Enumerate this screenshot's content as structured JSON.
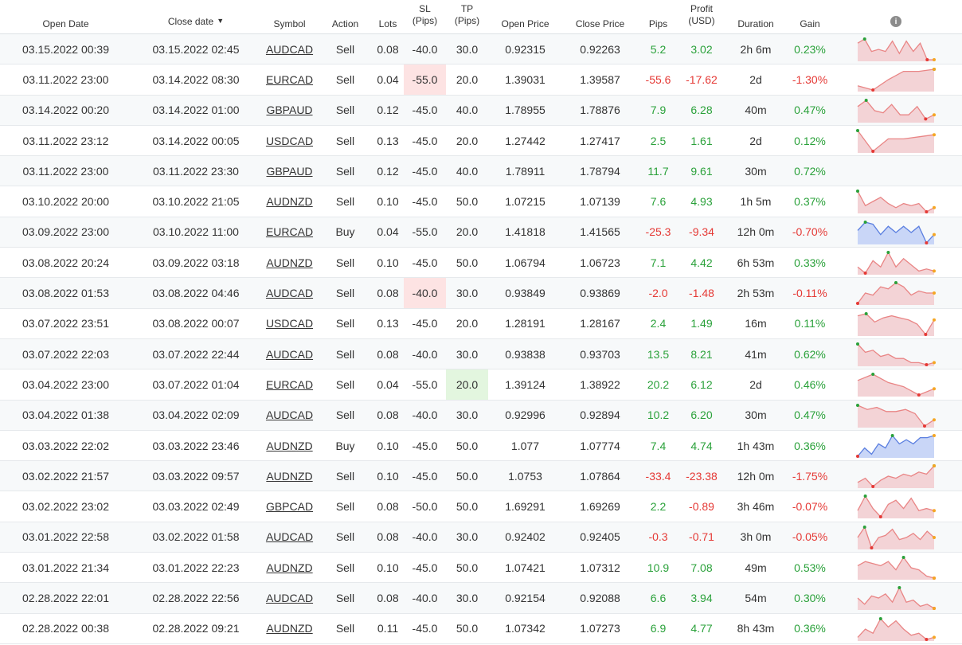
{
  "headers": {
    "open_date": "Open Date",
    "close_date": "Close date",
    "symbol": "Symbol",
    "action": "Action",
    "lots": "Lots",
    "sl_line1": "SL",
    "sl_line2": "(Pips)",
    "tp_line1": "TP",
    "tp_line2": "(Pips)",
    "open_price": "Open Price",
    "close_price": "Close Price",
    "pips": "Pips",
    "profit_line1": "Profit",
    "profit_line2": "(USD)",
    "duration": "Duration",
    "gain": "Gain",
    "sort_arrow": "▼",
    "info_icon": "i"
  },
  "colors": {
    "positive": "#2aa13a",
    "negative": "#e53935",
    "sell_fill": "#f3d3d6",
    "sell_line": "#e98585",
    "buy_fill": "#c9d6f7",
    "buy_line": "#5b7fe0"
  },
  "trades": [
    {
      "open": "03.15.2022 00:39",
      "close": "03.15.2022 02:45",
      "symbol": "AUDCAD",
      "action": "Sell",
      "lots": "0.08",
      "sl": "-40.0",
      "tp": "30.0",
      "open_price": "0.92315",
      "close_price": "0.92263",
      "pips": "5.2",
      "profit": "3.02",
      "duration": "2h 6m",
      "gain": "0.23%",
      "sign": "pos",
      "spark": [
        0.8,
        1.0,
        0.4,
        0.5,
        0.4,
        0.9,
        0.3,
        0.9,
        0.4,
        0.8,
        0.0,
        0.0
      ],
      "spark_type": "sell"
    },
    {
      "open": "03.11.2022 23:00",
      "close": "03.14.2022 08:30",
      "symbol": "EURCAD",
      "action": "Sell",
      "lots": "0.04",
      "sl": "-55.0",
      "tp": "20.0",
      "open_price": "1.39031",
      "close_price": "1.39587",
      "pips": "-55.6",
      "profit": "-17.62",
      "duration": "2d",
      "gain": "-1.30%",
      "sign": "neg",
      "sl_hl": "red",
      "spark": [
        0.2,
        0.0,
        0.5,
        0.9,
        0.9,
        1.0
      ],
      "spark_type": "sell"
    },
    {
      "open": "03.14.2022 00:20",
      "close": "03.14.2022 01:00",
      "symbol": "GBPAUD",
      "action": "Sell",
      "lots": "0.12",
      "sl": "-45.0",
      "tp": "40.0",
      "open_price": "1.78955",
      "close_price": "1.78876",
      "pips": "7.9",
      "profit": "6.28",
      "duration": "40m",
      "gain": "0.47%",
      "sign": "pos",
      "spark": [
        0.7,
        1.0,
        0.5,
        0.4,
        0.8,
        0.3,
        0.3,
        0.7,
        0.1,
        0.3
      ],
      "spark_type": "sell"
    },
    {
      "open": "03.11.2022 23:12",
      "close": "03.14.2022 00:05",
      "symbol": "USDCAD",
      "action": "Sell",
      "lots": "0.13",
      "sl": "-45.0",
      "tp": "20.0",
      "open_price": "1.27442",
      "close_price": "1.27417",
      "pips": "2.5",
      "profit": "1.61",
      "duration": "2d",
      "gain": "0.12%",
      "sign": "pos",
      "spark": [
        1.0,
        0.0,
        0.6,
        0.6,
        0.7,
        0.8
      ],
      "spark_type": "sell"
    },
    {
      "open": "03.11.2022 23:00",
      "close": "03.11.2022 23:30",
      "symbol": "GBPAUD",
      "action": "Sell",
      "lots": "0.12",
      "sl": "-45.0",
      "tp": "40.0",
      "open_price": "1.78911",
      "close_price": "1.78794",
      "pips": "11.7",
      "profit": "9.61",
      "duration": "30m",
      "gain": "0.72%",
      "sign": "pos",
      "spark": null,
      "spark_type": "none"
    },
    {
      "open": "03.10.2022 20:00",
      "close": "03.10.2022 21:05",
      "symbol": "AUDNZD",
      "action": "Sell",
      "lots": "0.10",
      "sl": "-45.0",
      "tp": "50.0",
      "open_price": "1.07215",
      "close_price": "1.07139",
      "pips": "7.6",
      "profit": "4.93",
      "duration": "1h 5m",
      "gain": "0.37%",
      "sign": "pos",
      "spark": [
        1.0,
        0.3,
        0.5,
        0.7,
        0.4,
        0.2,
        0.4,
        0.3,
        0.4,
        0.0,
        0.2
      ],
      "spark_type": "sell"
    },
    {
      "open": "03.09.2022 23:00",
      "close": "03.10.2022 11:00",
      "symbol": "EURCAD",
      "action": "Buy",
      "lots": "0.04",
      "sl": "-55.0",
      "tp": "20.0",
      "open_price": "1.41818",
      "close_price": "1.41565",
      "pips": "-25.3",
      "profit": "-9.34",
      "duration": "12h 0m",
      "gain": "-0.70%",
      "sign": "neg",
      "spark": [
        0.6,
        1.0,
        0.9,
        0.4,
        0.8,
        0.5,
        0.8,
        0.5,
        0.8,
        0.0,
        0.4
      ],
      "spark_type": "buy"
    },
    {
      "open": "03.08.2022 20:24",
      "close": "03.09.2022 03:18",
      "symbol": "AUDNZD",
      "action": "Sell",
      "lots": "0.10",
      "sl": "-45.0",
      "tp": "50.0",
      "open_price": "1.06794",
      "close_price": "1.06723",
      "pips": "7.1",
      "profit": "4.42",
      "duration": "6h 53m",
      "gain": "0.33%",
      "sign": "pos",
      "spark": [
        0.3,
        0.0,
        0.6,
        0.3,
        1.0,
        0.3,
        0.7,
        0.4,
        0.1,
        0.2,
        0.1
      ],
      "spark_type": "sell"
    },
    {
      "open": "03.08.2022 01:53",
      "close": "03.08.2022 04:46",
      "symbol": "AUDCAD",
      "action": "Sell",
      "lots": "0.08",
      "sl": "-40.0",
      "tp": "30.0",
      "open_price": "0.93849",
      "close_price": "0.93869",
      "pips": "-2.0",
      "profit": "-1.48",
      "duration": "2h 53m",
      "gain": "-0.11%",
      "sign": "neg",
      "sl_hl": "red",
      "spark": [
        0.0,
        0.5,
        0.4,
        0.8,
        0.7,
        1.0,
        0.8,
        0.4,
        0.6,
        0.5,
        0.5
      ],
      "spark_type": "sell"
    },
    {
      "open": "03.07.2022 23:51",
      "close": "03.08.2022 00:07",
      "symbol": "USDCAD",
      "action": "Sell",
      "lots": "0.13",
      "sl": "-45.0",
      "tp": "20.0",
      "open_price": "1.28191",
      "close_price": "1.28167",
      "pips": "2.4",
      "profit": "1.49",
      "duration": "16m",
      "gain": "0.11%",
      "sign": "pos",
      "spark": [
        0.9,
        1.0,
        0.6,
        0.8,
        0.9,
        0.8,
        0.7,
        0.5,
        0.0,
        0.7
      ],
      "spark_type": "sell"
    },
    {
      "open": "03.07.2022 22:03",
      "close": "03.07.2022 22:44",
      "symbol": "AUDCAD",
      "action": "Sell",
      "lots": "0.08",
      "sl": "-40.0",
      "tp": "30.0",
      "open_price": "0.93838",
      "close_price": "0.93703",
      "pips": "13.5",
      "profit": "8.21",
      "duration": "41m",
      "gain": "0.62%",
      "sign": "pos",
      "spark": [
        1.0,
        0.6,
        0.7,
        0.4,
        0.5,
        0.3,
        0.3,
        0.1,
        0.1,
        0.0,
        0.1
      ],
      "spark_type": "sell"
    },
    {
      "open": "03.04.2022 23:00",
      "close": "03.07.2022 01:04",
      "symbol": "EURCAD",
      "action": "Sell",
      "lots": "0.04",
      "sl": "-55.0",
      "tp": "20.0",
      "open_price": "1.39124",
      "close_price": "1.38922",
      "pips": "20.2",
      "profit": "6.12",
      "duration": "2d",
      "gain": "0.46%",
      "sign": "pos",
      "tp_hl": "green",
      "spark": [
        0.7,
        1.0,
        0.6,
        0.4,
        0.0,
        0.3
      ],
      "spark_type": "sell"
    },
    {
      "open": "03.04.2022 01:38",
      "close": "03.04.2022 02:09",
      "symbol": "AUDCAD",
      "action": "Sell",
      "lots": "0.08",
      "sl": "-40.0",
      "tp": "30.0",
      "open_price": "0.92996",
      "close_price": "0.92894",
      "pips": "10.2",
      "profit": "6.20",
      "duration": "30m",
      "gain": "0.47%",
      "sign": "pos",
      "spark": [
        1.0,
        0.8,
        0.9,
        0.7,
        0.7,
        0.8,
        0.6,
        0.0,
        0.3
      ],
      "spark_type": "sell"
    },
    {
      "open": "03.03.2022 22:02",
      "close": "03.03.2022 23:46",
      "symbol": "AUDNZD",
      "action": "Buy",
      "lots": "0.10",
      "sl": "-45.0",
      "tp": "50.0",
      "open_price": "1.077",
      "close_price": "1.07774",
      "pips": "7.4",
      "profit": "4.74",
      "duration": "1h 43m",
      "gain": "0.36%",
      "sign": "pos",
      "spark": [
        0.0,
        0.4,
        0.1,
        0.6,
        0.4,
        1.0,
        0.6,
        0.8,
        0.6,
        0.9,
        0.9,
        1.0
      ],
      "spark_type": "buy"
    },
    {
      "open": "03.02.2022 21:57",
      "close": "03.03.2022 09:57",
      "symbol": "AUDNZD",
      "action": "Sell",
      "lots": "0.10",
      "sl": "-45.0",
      "tp": "50.0",
      "open_price": "1.0753",
      "close_price": "1.07864",
      "pips": "-33.4",
      "profit": "-23.38",
      "duration": "12h 0m",
      "gain": "-1.75%",
      "sign": "neg",
      "spark": [
        0.2,
        0.4,
        0.0,
        0.3,
        0.5,
        0.4,
        0.6,
        0.5,
        0.7,
        0.6,
        1.0
      ],
      "spark_type": "sell"
    },
    {
      "open": "03.02.2022 23:02",
      "close": "03.03.2022 02:49",
      "symbol": "GBPCAD",
      "action": "Sell",
      "lots": "0.08",
      "sl": "-50.0",
      "tp": "50.0",
      "open_price": "1.69291",
      "close_price": "1.69269",
      "pips": "2.2",
      "profit": "-0.89",
      "duration": "3h 46m",
      "gain": "-0.07%",
      "sign": "mixed",
      "spark": [
        0.3,
        1.0,
        0.4,
        0.0,
        0.6,
        0.8,
        0.4,
        0.9,
        0.3,
        0.4,
        0.3
      ],
      "spark_type": "sell"
    },
    {
      "open": "03.01.2022 22:58",
      "close": "03.02.2022 01:58",
      "symbol": "AUDCAD",
      "action": "Sell",
      "lots": "0.08",
      "sl": "-40.0",
      "tp": "30.0",
      "open_price": "0.92402",
      "close_price": "0.92405",
      "pips": "-0.3",
      "profit": "-0.71",
      "duration": "3h 0m",
      "gain": "-0.05%",
      "sign": "neg",
      "spark": [
        0.5,
        1.0,
        0.0,
        0.5,
        0.6,
        0.9,
        0.4,
        0.5,
        0.7,
        0.4,
        0.8,
        0.5
      ],
      "spark_type": "sell"
    },
    {
      "open": "03.01.2022 21:34",
      "close": "03.01.2022 22:23",
      "symbol": "AUDNZD",
      "action": "Sell",
      "lots": "0.10",
      "sl": "-45.0",
      "tp": "50.0",
      "open_price": "1.07421",
      "close_price": "1.07312",
      "pips": "10.9",
      "profit": "7.08",
      "duration": "49m",
      "gain": "0.53%",
      "sign": "pos",
      "spark": [
        0.6,
        0.8,
        0.7,
        0.6,
        0.8,
        0.4,
        1.0,
        0.5,
        0.4,
        0.1,
        0.0
      ],
      "spark_type": "sell"
    },
    {
      "open": "02.28.2022 22:01",
      "close": "02.28.2022 22:56",
      "symbol": "AUDCAD",
      "action": "Sell",
      "lots": "0.08",
      "sl": "-40.0",
      "tp": "30.0",
      "open_price": "0.92154",
      "close_price": "0.92088",
      "pips": "6.6",
      "profit": "3.94",
      "duration": "54m",
      "gain": "0.30%",
      "sign": "pos",
      "spark": [
        0.5,
        0.2,
        0.6,
        0.5,
        0.7,
        0.3,
        1.0,
        0.3,
        0.4,
        0.1,
        0.2,
        0.0
      ],
      "spark_type": "sell"
    },
    {
      "open": "02.28.2022 00:38",
      "close": "02.28.2022 09:21",
      "symbol": "AUDNZD",
      "action": "Sell",
      "lots": "0.11",
      "sl": "-45.0",
      "tp": "50.0",
      "open_price": "1.07342",
      "close_price": "1.07273",
      "pips": "6.9",
      "profit": "4.77",
      "duration": "8h 43m",
      "gain": "0.36%",
      "sign": "pos",
      "spark": [
        0.1,
        0.5,
        0.3,
        1.0,
        0.6,
        0.9,
        0.5,
        0.2,
        0.3,
        0.0,
        0.1
      ],
      "spark_type": "sell"
    }
  ]
}
